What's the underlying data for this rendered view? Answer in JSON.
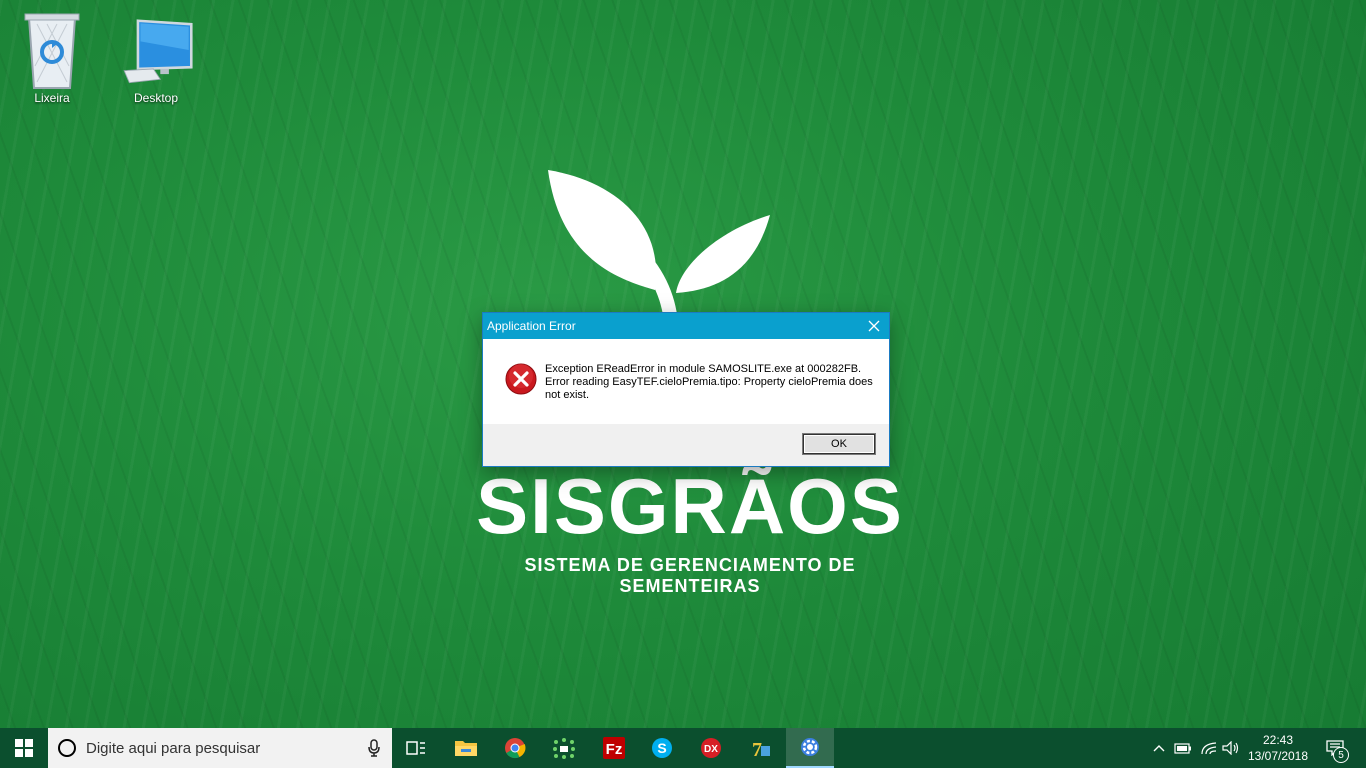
{
  "desktop": {
    "icons": [
      {
        "label": "Lixeira"
      },
      {
        "label": "Desktop"
      }
    ]
  },
  "wallpaper": {
    "title": "SISGRÃOS",
    "subtitle": "SISTEMA DE GERENCIAMENTO DE SEMENTEIRAS"
  },
  "dialog": {
    "title": "Application Error",
    "message": "Exception EReadError in module SAMOSLITE.exe at 000282FB. Error reading EasyTEF.cieloPremia.tipo: Property cieloPremia does not exist.",
    "ok_label": "OK"
  },
  "taskbar": {
    "search_placeholder": "Digite aqui para pesquisar",
    "apps": [
      "task-view",
      "file-explorer",
      "chrome",
      "app-green",
      "filezilla",
      "skype",
      "dx",
      "7zip",
      "settings"
    ],
    "clock_time": "22:43",
    "clock_date": "13/07/2018",
    "notification_count": "5"
  },
  "colors": {
    "titlebar": "#0aa0ce",
    "taskbar": "#0b4f2e",
    "wallpaper": "#1e8a3a"
  }
}
